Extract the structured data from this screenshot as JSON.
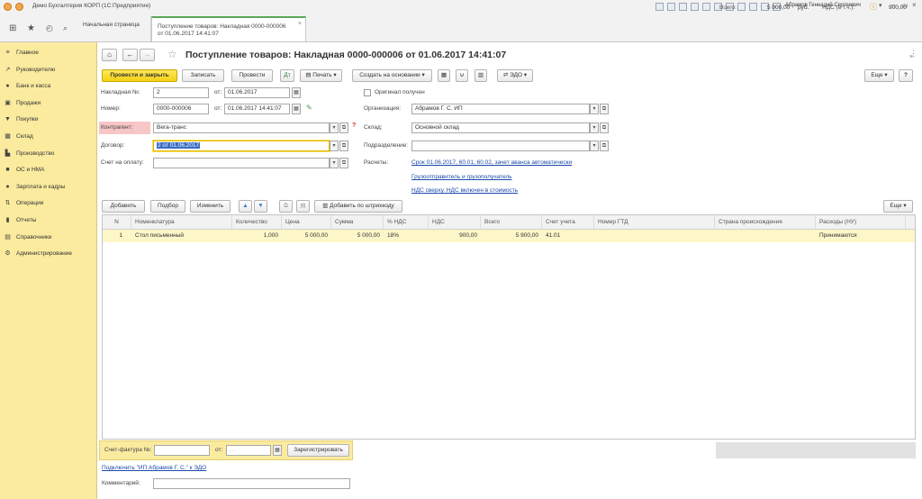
{
  "window": {
    "title": "Демо Бухгалтерия КОРП (1С:Предприятие)",
    "user": "Абрамов Геннадий Сергеевич"
  },
  "tabs": [
    {
      "label": "Начальная страница"
    },
    {
      "label_line1": "Поступление товаров: Накладная 0000-000006",
      "label_line2": "от 01.06.2017 14:41:07",
      "close": "×"
    }
  ],
  "sidebar": {
    "items": [
      {
        "label": "Главное",
        "icon": "≡"
      },
      {
        "label": "Руководителю",
        "icon": "↗"
      },
      {
        "label": "Банк и касса",
        "icon": "●"
      },
      {
        "label": "Продажи",
        "icon": "▣"
      },
      {
        "label": "Покупки",
        "icon": "▼"
      },
      {
        "label": "Склад",
        "icon": "▦"
      },
      {
        "label": "Производство",
        "icon": "▙"
      },
      {
        "label": "ОС и НМА",
        "icon": "■"
      },
      {
        "label": "Зарплата и кадры",
        "icon": "●"
      },
      {
        "label": "Операции",
        "icon": "⇅"
      },
      {
        "label": "Отчеты",
        "icon": "▮"
      },
      {
        "label": "Справочники",
        "icon": "▤"
      },
      {
        "label": "Администрирование",
        "icon": "⚙"
      }
    ]
  },
  "document": {
    "title": "Поступление товаров: Накладная 0000-000006 от 01.06.2017 14:41:07"
  },
  "toolbar": {
    "post_close": "Провести и закрыть",
    "save": "Записать",
    "post": "Провести",
    "print": "Печать",
    "create_based": "Создать на основании",
    "edo": "ЭДО",
    "more": "Еще",
    "help": "?"
  },
  "form": {
    "invoice_no_label": "Накладная №:",
    "invoice_no_value": "2",
    "from_label": "от:",
    "invoice_date": "01.06.2017",
    "number_label": "Номер:",
    "number_value": "0000-000006",
    "number_date": "01.06.2017 14:41:07",
    "contractor_label": "Контрагент:",
    "contractor_value": "Вега-транс",
    "contract_label": "Договор:",
    "contract_value": "2 от 01.06.2017",
    "pay_account_label": "Счет на оплату:",
    "pay_account_value": "",
    "original_label": "Оригинал получен",
    "org_label": "Организация:",
    "org_value": "Абрамов Г. С. ИП",
    "warehouse_label": "Склад:",
    "warehouse_value": "Основной склад",
    "division_label": "Подразделение:",
    "division_value": "",
    "settlements_label": "Расчеты:",
    "settlements_link": "Срок 01.06.2017, 60.01, 60.02, зачет аванса автоматически",
    "shipper_link": "Грузоотправитель и грузополучатель",
    "vat_link": "НДС сверху. НДС включен в стоимость"
  },
  "table_toolbar": {
    "add": "Добавить",
    "pick": "Подбор",
    "change": "Изменить",
    "barcode": "Добавить по штрихкоду",
    "more": "Еще"
  },
  "table": {
    "columns": [
      "N",
      "Номенклатура",
      "Количество",
      "Цена",
      "Сумма",
      "% НДС",
      "НДС",
      "Всего",
      "Счет учета",
      "Номер ГТД",
      "Страна происхождения",
      "Расходы (НУ)"
    ],
    "rows": [
      [
        "1",
        "Стол письменный",
        "1,000",
        "5 000,00",
        "5 000,00",
        "18%",
        "900,00",
        "5 900,00",
        "41.01",
        "",
        "",
        "Принимаются"
      ]
    ]
  },
  "footer": {
    "invoice_label": "Счет-фактура №:",
    "invoice_value": "",
    "from_label": "от:",
    "invoice_date_placeholder": ". .",
    "register_button": "Зарегистрировать",
    "edo_link": "Подключить \"ИП Абрамов Г. С.\" к ЭДО",
    "comment_label": "Комментарий:",
    "comment_value": "",
    "total_label": "Всего:",
    "total_value": "5 900,00",
    "currency": "руб.",
    "vat_label": "НДС (в т.ч.):",
    "vat_value": "900,00"
  }
}
